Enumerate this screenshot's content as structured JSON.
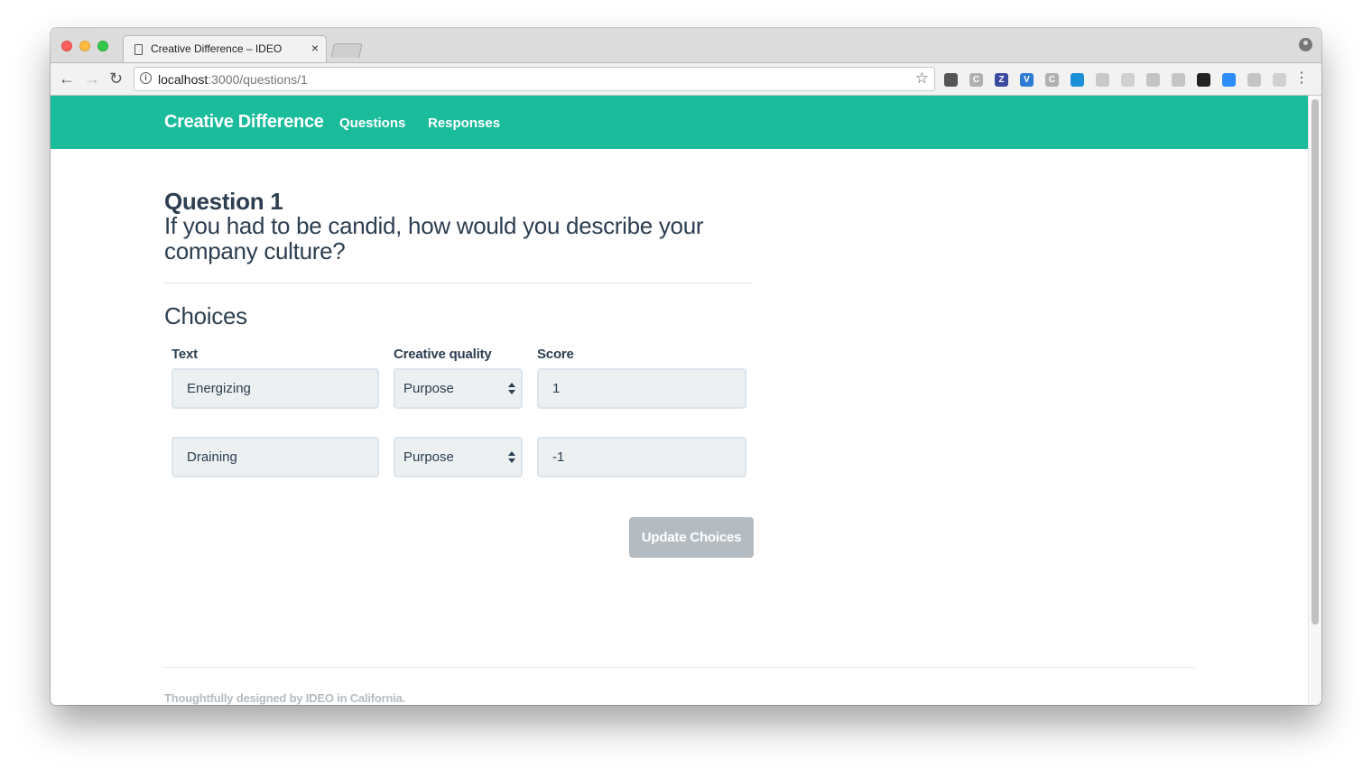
{
  "browser": {
    "tab_title": "Creative Difference – IDEO",
    "tab_close": "×",
    "url_host": "localhost",
    "url_path": ":3000/questions/1",
    "back_glyph": "←",
    "forward_glyph": "→",
    "reload_glyph": "↻",
    "star_glyph": "☆",
    "menu_glyph": "⋮",
    "extensions": [
      {
        "icon": "password-icon",
        "label": "",
        "color": "#555555"
      },
      {
        "icon": "c-icon",
        "label": "C",
        "color": "#b0b0b0"
      },
      {
        "icon": "z-icon",
        "label": "Z",
        "color": "#3a4a9f"
      },
      {
        "icon": "v-icon",
        "label": "V",
        "color": "#2e7bd6"
      },
      {
        "icon": "c-icon",
        "label": "C",
        "color": "#b0b0b0"
      },
      {
        "icon": "ring-icon",
        "label": "",
        "color": "#1b8fd8"
      },
      {
        "icon": "drive-icon",
        "label": "",
        "color": "#c8c8c8"
      },
      {
        "icon": "circle-icon",
        "label": "",
        "color": "#d0d0d0"
      },
      {
        "icon": "trello-icon",
        "label": "",
        "color": "#c4c4c4"
      },
      {
        "icon": "bulb-icon",
        "label": "",
        "color": "#c4c4c4"
      },
      {
        "icon": "wave-icon",
        "label": "",
        "color": "#222222"
      },
      {
        "icon": "video-icon",
        "label": "",
        "color": "#2d8cff"
      },
      {
        "icon": "cards-icon",
        "label": "",
        "color": "#c4c4c4"
      },
      {
        "icon": "phone-icon",
        "label": "",
        "color": "#d0d0d0"
      }
    ]
  },
  "navbar": {
    "brand": "Creative Difference",
    "links": [
      "Questions",
      "Responses"
    ],
    "color": "#1abc9c"
  },
  "question": {
    "title": "Question 1",
    "text": "If you had to be candid, how would you describe your company culture?"
  },
  "choices": {
    "heading": "Choices",
    "columns": [
      "Text",
      "Creative quality",
      "Score"
    ],
    "rows": [
      {
        "text": "Energizing",
        "quality": "Purpose",
        "score": "1"
      },
      {
        "text": "Draining",
        "quality": "Purpose",
        "score": "-1"
      }
    ],
    "submit_label": "Update Choices"
  },
  "footer": {
    "text": "Thoughtfully designed by IDEO in California."
  }
}
